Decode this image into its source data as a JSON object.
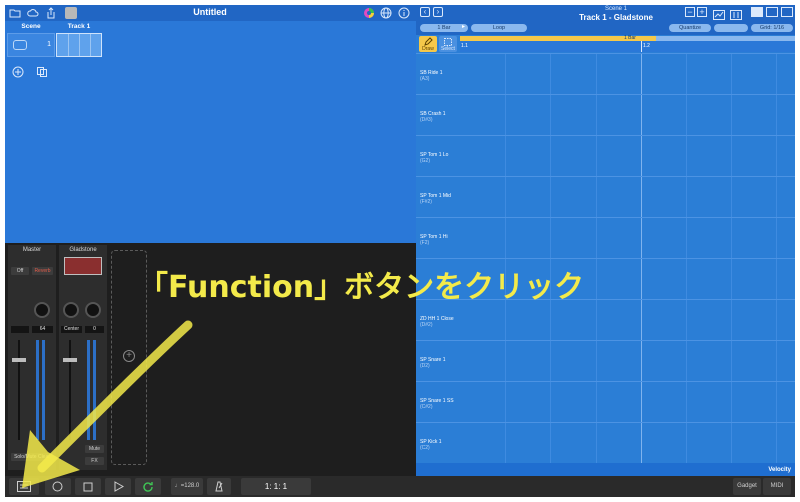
{
  "app": {
    "title": "Untitled",
    "scene_header": "Scene",
    "track_header": "Track 1",
    "scene_number": "1"
  },
  "piano_roll": {
    "scene_label": "Scene 1",
    "title": "Track 1 - Gladstone",
    "length_label": "1 Bar",
    "loop_label": "Loop",
    "quantize_label": "Quantize",
    "grid_label": "Grid: 1/16",
    "loop_bar_label": "1 Bar",
    "marker_1": "1.1",
    "marker_2": "1.2",
    "draw_label": "Draw",
    "select_label": "Select",
    "velocity_label": "Velocity",
    "keys": [
      {
        "name": "SB Ride 1",
        "note": "(A3)"
      },
      {
        "name": "SB Crash 1",
        "note": "(D#3)"
      },
      {
        "name": "SP Tom 1 Lo",
        "note": "(G2)"
      },
      {
        "name": "SP Tom 1 Mid",
        "note": "(F#2)"
      },
      {
        "name": "SP Tom 1 Hi",
        "note": "(F2)"
      },
      {
        "name": "",
        "note": ""
      },
      {
        "name": "ZD HH 1 Close",
        "note": "(D#2)"
      },
      {
        "name": "SP Snare 1",
        "note": "(D2)"
      },
      {
        "name": "SP Snare 1 SS",
        "note": "(C#2)"
      },
      {
        "name": "SP Kick 1",
        "note": "(C2)"
      }
    ]
  },
  "mixer": {
    "master_label": "Master",
    "track_label": "Gladstone",
    "off_label": "Off",
    "reverb_label": "Reverb",
    "master_value": "64",
    "pan_label": "Center",
    "track_value": "0",
    "solo_mute_label": "Solo/Mute Clear",
    "mute_label": "Mute",
    "fx_label": "FX"
  },
  "transport": {
    "tempo": "♩=128.0",
    "position": "1:   1:   1",
    "gadget_label": "Gadget",
    "midi_label": "MIDI"
  },
  "annotation": {
    "text": "「Function」ボタンをクリック"
  },
  "colors": {
    "annotation": "#f3ea4a",
    "accent_blue": "#2a78d8",
    "loop_yellow": "#f5c84a"
  }
}
